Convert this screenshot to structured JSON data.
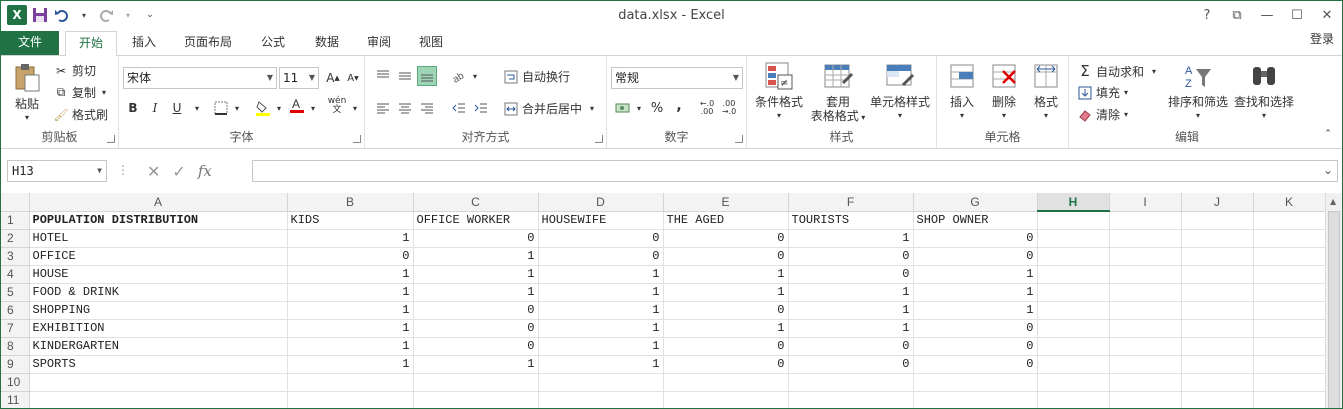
{
  "app": {
    "title": "data.xlsx - Excel",
    "logo": "X",
    "login": "登录",
    "icons": {
      "save": "save-icon",
      "undo": "undo-icon",
      "redo": "redo-icon",
      "customize": "customize-qat-icon"
    }
  },
  "window_controls": {
    "help": "?",
    "restore_ribbon": "⧉",
    "minimize": "—",
    "maximize": "☐",
    "close": "✕"
  },
  "tabs": {
    "file": "文件",
    "items": [
      "开始",
      "插入",
      "页面布局",
      "公式",
      "数据",
      "审阅",
      "视图"
    ],
    "active": "开始"
  },
  "ribbon": {
    "clipboard": {
      "label": "剪贴板",
      "paste": "粘贴",
      "cut": "剪切",
      "copy": "复制",
      "format_painter": "格式刷"
    },
    "font": {
      "label": "字体",
      "font_name": "宋体",
      "font_size": "11",
      "bold": "B",
      "italic": "I",
      "underline": "U",
      "grow": "A",
      "shrink": "A",
      "phonetic": "wén"
    },
    "alignment": {
      "label": "对齐方式",
      "wrap_text": "自动换行",
      "merge_center": "合并后居中"
    },
    "number": {
      "label": "数字",
      "format": "常规",
      "percent": "%",
      "comma": ","
    },
    "styles": {
      "label": "样式",
      "conditional": "条件格式",
      "table_format_1": "套用",
      "table_format_2": "表格格式",
      "cell_styles": "单元格样式"
    },
    "cells": {
      "label": "单元格",
      "insert": "插入",
      "delete": "删除",
      "format": "格式"
    },
    "editing": {
      "label": "编辑",
      "autosum": "自动求和",
      "fill": "填充",
      "clear": "清除",
      "sort_filter": "排序和筛选",
      "find_select": "查找和选择"
    }
  },
  "formula_bar": {
    "name_box": "H13",
    "fx": "fx",
    "formula": ""
  },
  "sheet": {
    "columns": [
      "A",
      "B",
      "C",
      "D",
      "E",
      "F",
      "G",
      "H",
      "I",
      "J",
      "K"
    ],
    "selected_column": "H",
    "rows": [
      {
        "n": "1",
        "a": "POPULATION DISTRIBUTION",
        "cells": [
          "KIDS",
          "OFFICE WORKER",
          "HOUSEWIFE",
          "THE AGED",
          "TOURISTS",
          "SHOP OWNER"
        ]
      },
      {
        "n": "2",
        "a": "HOTEL",
        "cells": [
          "1",
          "0",
          "0",
          "0",
          "1",
          "0"
        ]
      },
      {
        "n": "3",
        "a": "OFFICE",
        "cells": [
          "0",
          "1",
          "0",
          "0",
          "0",
          "0"
        ]
      },
      {
        "n": "4",
        "a": "HOUSE",
        "cells": [
          "1",
          "1",
          "1",
          "1",
          "0",
          "1"
        ]
      },
      {
        "n": "5",
        "a": "FOOD & DRINK",
        "cells": [
          "1",
          "1",
          "1",
          "1",
          "1",
          "1"
        ]
      },
      {
        "n": "6",
        "a": "SHOPPING",
        "cells": [
          "1",
          "0",
          "1",
          "0",
          "1",
          "1"
        ]
      },
      {
        "n": "7",
        "a": "EXHIBITION",
        "cells": [
          "1",
          "0",
          "1",
          "1",
          "1",
          "0"
        ]
      },
      {
        "n": "8",
        "a": "KINDERGARTEN",
        "cells": [
          "1",
          "0",
          "1",
          "0",
          "0",
          "0"
        ]
      },
      {
        "n": "9",
        "a": "SPORTS",
        "cells": [
          "1",
          "1",
          "1",
          "0",
          "0",
          "0"
        ]
      },
      {
        "n": "10",
        "a": "",
        "cells": [
          "",
          "",
          "",
          "",
          "",
          ""
        ]
      },
      {
        "n": "11",
        "a": "",
        "cells": [
          "",
          "",
          "",
          "",
          "",
          ""
        ]
      }
    ]
  }
}
